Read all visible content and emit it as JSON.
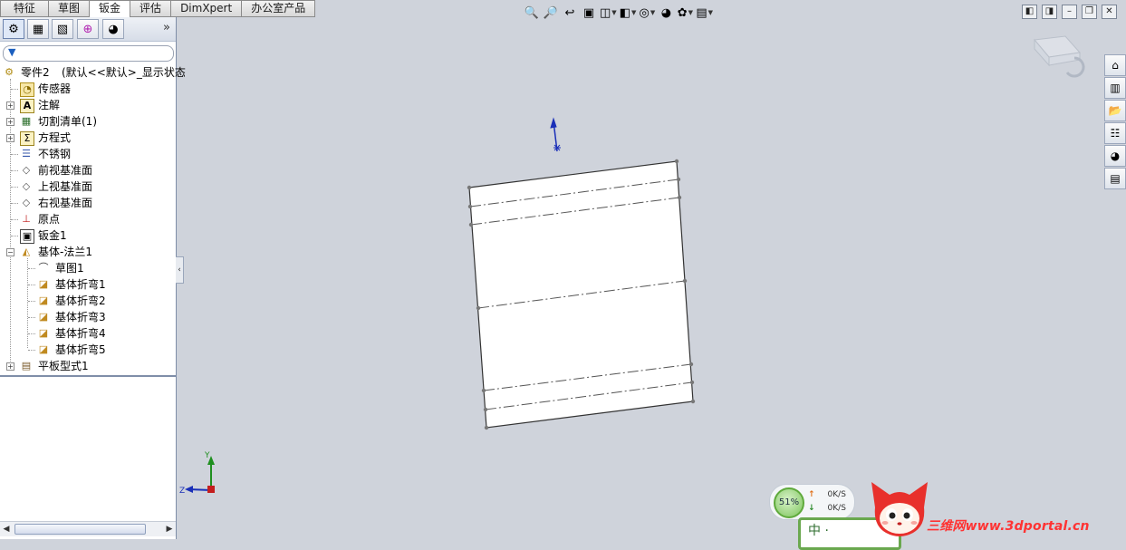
{
  "command_tabs": [
    "特征",
    "草图",
    "钣金",
    "评估",
    "DimXpert",
    "办公室产品"
  ],
  "active_tab": "钣金",
  "feature_tree": {
    "root_label": "零件2",
    "root_config": "(默认<<默认>_显示状态",
    "items": [
      {
        "label": "传感器",
        "icon": "sensor-icon"
      },
      {
        "label": "注解",
        "icon": "annotation-icon"
      },
      {
        "label": "切割清单(1)",
        "icon": "cut-list-icon"
      },
      {
        "label": "方程式",
        "icon": "equation-icon"
      },
      {
        "label": "不锈钢",
        "icon": "material-icon"
      },
      {
        "label": "前视基准面",
        "icon": "plane-icon"
      },
      {
        "label": "上视基准面",
        "icon": "plane-icon"
      },
      {
        "label": "右视基准面",
        "icon": "plane-icon"
      },
      {
        "label": "原点",
        "icon": "origin-icon"
      },
      {
        "label": "钣金1",
        "icon": "sheet-metal-icon"
      },
      {
        "label": "基体-法兰1",
        "icon": "base-flange-icon"
      }
    ],
    "flange_children": [
      {
        "label": "草图1",
        "icon": "sketch-icon"
      },
      {
        "label": "基体折弯1",
        "icon": "bend-icon"
      },
      {
        "label": "基体折弯2",
        "icon": "bend-icon"
      },
      {
        "label": "基体折弯3",
        "icon": "bend-icon"
      },
      {
        "label": "基体折弯4",
        "icon": "bend-icon"
      },
      {
        "label": "基体折弯5",
        "icon": "bend-icon"
      }
    ],
    "last_item": {
      "label": "平板型式1",
      "icon": "flat-pattern-icon"
    }
  },
  "triad": {
    "y": "Y",
    "z": "Z"
  },
  "network": {
    "percent": "51%",
    "up": "0K/S",
    "down": "0K/S"
  },
  "green_box_text": "中 ·",
  "watermark": "三维网www.3dportal.cn",
  "colors": {
    "viewport_bg": "#cfd3db",
    "panel_border": "#7f8ea8",
    "accent": "#1b5fbf",
    "watermark": "#ff3333"
  }
}
